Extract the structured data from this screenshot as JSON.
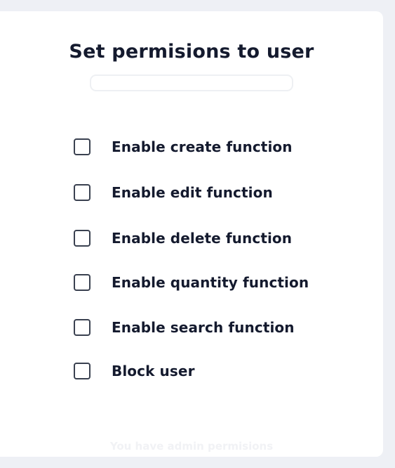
{
  "dialog": {
    "title": "Set permisions to user",
    "user_field": {
      "value": "",
      "placeholder": ""
    },
    "permissions": [
      {
        "label": "Enable create function",
        "checked": false
      },
      {
        "label": "Enable edit function",
        "checked": false
      },
      {
        "label": "Enable delete function",
        "checked": false
      },
      {
        "label": "Enable quantity function",
        "checked": false
      },
      {
        "label": "Enable search function",
        "checked": false
      },
      {
        "label": "Block user",
        "checked": false
      }
    ],
    "footer_note": "You have admin permisions"
  },
  "colors": {
    "page_background": "#eef0f5",
    "card_background": "#ffffff",
    "text": "#141a2e",
    "checkbox_border": "#3a4150",
    "footer_text": "#f1f2f5"
  }
}
